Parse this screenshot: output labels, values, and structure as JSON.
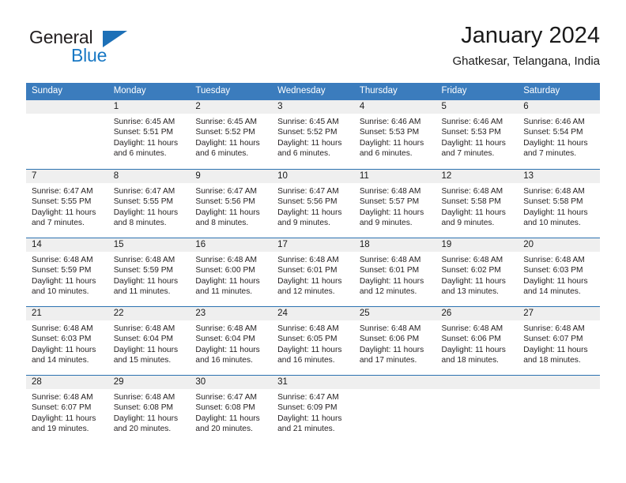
{
  "brand": {
    "name_part1": "General",
    "name_part2": "Blue",
    "triangle_icon": "triangle-icon"
  },
  "header": {
    "title": "January 2024",
    "location": "Ghatkesar, Telangana, India"
  },
  "colors": {
    "header_blue": "#3b7cbd",
    "row_divider_blue": "#2c72b0",
    "daynum_band": "#efefef",
    "brand_blue": "#1878c4",
    "text": "#231f20"
  },
  "weekday_headers": [
    "Sunday",
    "Monday",
    "Tuesday",
    "Wednesday",
    "Thursday",
    "Friday",
    "Saturday"
  ],
  "labels": {
    "sunrise_prefix": "Sunrise:",
    "sunset_prefix": "Sunset:",
    "daylight_prefix": "Daylight:"
  },
  "weeks": [
    [
      {
        "day": "",
        "sunrise": "",
        "sunset": "",
        "daylight_line1": "",
        "daylight_line2": "",
        "empty": true
      },
      {
        "day": "1",
        "sunrise": "Sunrise: 6:45 AM",
        "sunset": "Sunset: 5:51 PM",
        "daylight_line1": "Daylight: 11 hours",
        "daylight_line2": "and 6 minutes."
      },
      {
        "day": "2",
        "sunrise": "Sunrise: 6:45 AM",
        "sunset": "Sunset: 5:52 PM",
        "daylight_line1": "Daylight: 11 hours",
        "daylight_line2": "and 6 minutes."
      },
      {
        "day": "3",
        "sunrise": "Sunrise: 6:45 AM",
        "sunset": "Sunset: 5:52 PM",
        "daylight_line1": "Daylight: 11 hours",
        "daylight_line2": "and 6 minutes."
      },
      {
        "day": "4",
        "sunrise": "Sunrise: 6:46 AM",
        "sunset": "Sunset: 5:53 PM",
        "daylight_line1": "Daylight: 11 hours",
        "daylight_line2": "and 6 minutes."
      },
      {
        "day": "5",
        "sunrise": "Sunrise: 6:46 AM",
        "sunset": "Sunset: 5:53 PM",
        "daylight_line1": "Daylight: 11 hours",
        "daylight_line2": "and 7 minutes."
      },
      {
        "day": "6",
        "sunrise": "Sunrise: 6:46 AM",
        "sunset": "Sunset: 5:54 PM",
        "daylight_line1": "Daylight: 11 hours",
        "daylight_line2": "and 7 minutes."
      }
    ],
    [
      {
        "day": "7",
        "sunrise": "Sunrise: 6:47 AM",
        "sunset": "Sunset: 5:55 PM",
        "daylight_line1": "Daylight: 11 hours",
        "daylight_line2": "and 7 minutes."
      },
      {
        "day": "8",
        "sunrise": "Sunrise: 6:47 AM",
        "sunset": "Sunset: 5:55 PM",
        "daylight_line1": "Daylight: 11 hours",
        "daylight_line2": "and 8 minutes."
      },
      {
        "day": "9",
        "sunrise": "Sunrise: 6:47 AM",
        "sunset": "Sunset: 5:56 PM",
        "daylight_line1": "Daylight: 11 hours",
        "daylight_line2": "and 8 minutes."
      },
      {
        "day": "10",
        "sunrise": "Sunrise: 6:47 AM",
        "sunset": "Sunset: 5:56 PM",
        "daylight_line1": "Daylight: 11 hours",
        "daylight_line2": "and 9 minutes."
      },
      {
        "day": "11",
        "sunrise": "Sunrise: 6:48 AM",
        "sunset": "Sunset: 5:57 PM",
        "daylight_line1": "Daylight: 11 hours",
        "daylight_line2": "and 9 minutes."
      },
      {
        "day": "12",
        "sunrise": "Sunrise: 6:48 AM",
        "sunset": "Sunset: 5:58 PM",
        "daylight_line1": "Daylight: 11 hours",
        "daylight_line2": "and 9 minutes."
      },
      {
        "day": "13",
        "sunrise": "Sunrise: 6:48 AM",
        "sunset": "Sunset: 5:58 PM",
        "daylight_line1": "Daylight: 11 hours",
        "daylight_line2": "and 10 minutes."
      }
    ],
    [
      {
        "day": "14",
        "sunrise": "Sunrise: 6:48 AM",
        "sunset": "Sunset: 5:59 PM",
        "daylight_line1": "Daylight: 11 hours",
        "daylight_line2": "and 10 minutes."
      },
      {
        "day": "15",
        "sunrise": "Sunrise: 6:48 AM",
        "sunset": "Sunset: 5:59 PM",
        "daylight_line1": "Daylight: 11 hours",
        "daylight_line2": "and 11 minutes."
      },
      {
        "day": "16",
        "sunrise": "Sunrise: 6:48 AM",
        "sunset": "Sunset: 6:00 PM",
        "daylight_line1": "Daylight: 11 hours",
        "daylight_line2": "and 11 minutes."
      },
      {
        "day": "17",
        "sunrise": "Sunrise: 6:48 AM",
        "sunset": "Sunset: 6:01 PM",
        "daylight_line1": "Daylight: 11 hours",
        "daylight_line2": "and 12 minutes."
      },
      {
        "day": "18",
        "sunrise": "Sunrise: 6:48 AM",
        "sunset": "Sunset: 6:01 PM",
        "daylight_line1": "Daylight: 11 hours",
        "daylight_line2": "and 12 minutes."
      },
      {
        "day": "19",
        "sunrise": "Sunrise: 6:48 AM",
        "sunset": "Sunset: 6:02 PM",
        "daylight_line1": "Daylight: 11 hours",
        "daylight_line2": "and 13 minutes."
      },
      {
        "day": "20",
        "sunrise": "Sunrise: 6:48 AM",
        "sunset": "Sunset: 6:03 PM",
        "daylight_line1": "Daylight: 11 hours",
        "daylight_line2": "and 14 minutes."
      }
    ],
    [
      {
        "day": "21",
        "sunrise": "Sunrise: 6:48 AM",
        "sunset": "Sunset: 6:03 PM",
        "daylight_line1": "Daylight: 11 hours",
        "daylight_line2": "and 14 minutes."
      },
      {
        "day": "22",
        "sunrise": "Sunrise: 6:48 AM",
        "sunset": "Sunset: 6:04 PM",
        "daylight_line1": "Daylight: 11 hours",
        "daylight_line2": "and 15 minutes."
      },
      {
        "day": "23",
        "sunrise": "Sunrise: 6:48 AM",
        "sunset": "Sunset: 6:04 PM",
        "daylight_line1": "Daylight: 11 hours",
        "daylight_line2": "and 16 minutes."
      },
      {
        "day": "24",
        "sunrise": "Sunrise: 6:48 AM",
        "sunset": "Sunset: 6:05 PM",
        "daylight_line1": "Daylight: 11 hours",
        "daylight_line2": "and 16 minutes."
      },
      {
        "day": "25",
        "sunrise": "Sunrise: 6:48 AM",
        "sunset": "Sunset: 6:06 PM",
        "daylight_line1": "Daylight: 11 hours",
        "daylight_line2": "and 17 minutes."
      },
      {
        "day": "26",
        "sunrise": "Sunrise: 6:48 AM",
        "sunset": "Sunset: 6:06 PM",
        "daylight_line1": "Daylight: 11 hours",
        "daylight_line2": "and 18 minutes."
      },
      {
        "day": "27",
        "sunrise": "Sunrise: 6:48 AM",
        "sunset": "Sunset: 6:07 PM",
        "daylight_line1": "Daylight: 11 hours",
        "daylight_line2": "and 18 minutes."
      }
    ],
    [
      {
        "day": "28",
        "sunrise": "Sunrise: 6:48 AM",
        "sunset": "Sunset: 6:07 PM",
        "daylight_line1": "Daylight: 11 hours",
        "daylight_line2": "and 19 minutes."
      },
      {
        "day": "29",
        "sunrise": "Sunrise: 6:48 AM",
        "sunset": "Sunset: 6:08 PM",
        "daylight_line1": "Daylight: 11 hours",
        "daylight_line2": "and 20 minutes."
      },
      {
        "day": "30",
        "sunrise": "Sunrise: 6:47 AM",
        "sunset": "Sunset: 6:08 PM",
        "daylight_line1": "Daylight: 11 hours",
        "daylight_line2": "and 20 minutes."
      },
      {
        "day": "31",
        "sunrise": "Sunrise: 6:47 AM",
        "sunset": "Sunset: 6:09 PM",
        "daylight_line1": "Daylight: 11 hours",
        "daylight_line2": "and 21 minutes."
      },
      {
        "day": "",
        "sunrise": "",
        "sunset": "",
        "daylight_line1": "",
        "daylight_line2": "",
        "empty": true,
        "blank": true
      },
      {
        "day": "",
        "sunrise": "",
        "sunset": "",
        "daylight_line1": "",
        "daylight_line2": "",
        "empty": true,
        "blank": true
      },
      {
        "day": "",
        "sunrise": "",
        "sunset": "",
        "daylight_line1": "",
        "daylight_line2": "",
        "empty": true,
        "blank": true
      }
    ]
  ]
}
